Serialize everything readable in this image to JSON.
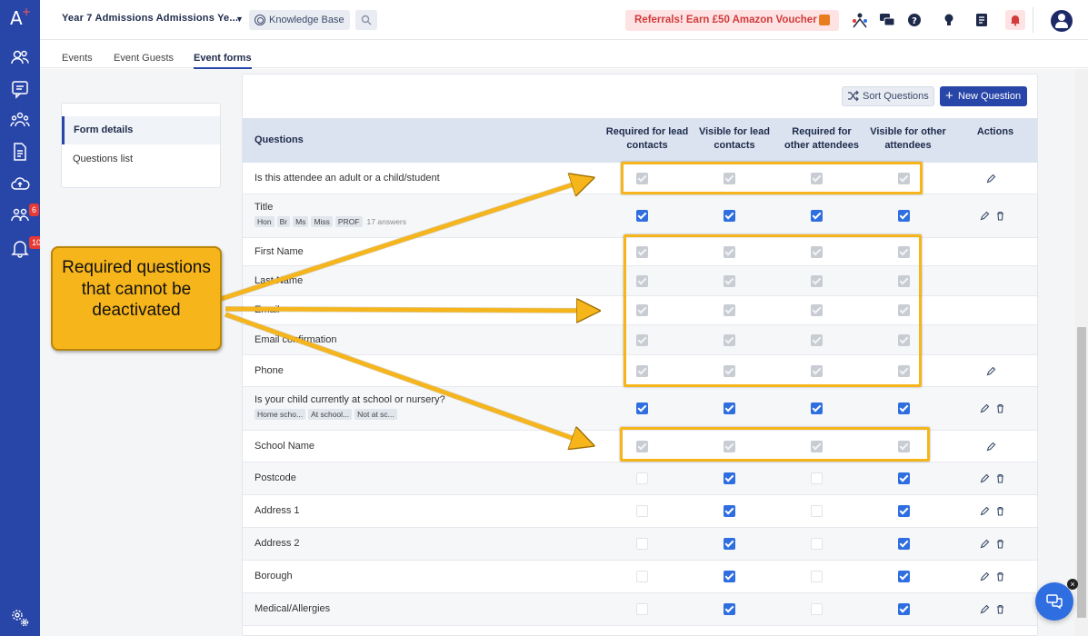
{
  "app": {
    "logo": "A",
    "logo_plus": "+"
  },
  "leftnav": {
    "items": [
      {
        "icon": "people-icon"
      },
      {
        "icon": "chat-icon"
      },
      {
        "icon": "group-icon"
      },
      {
        "icon": "document-icon"
      },
      {
        "icon": "upload-cloud-icon"
      },
      {
        "icon": "team-icon",
        "badge": "6"
      },
      {
        "icon": "bell-icon",
        "badge": "10"
      },
      {
        "icon": "settings-icon"
      }
    ]
  },
  "topbar": {
    "project_title": "Year 7 Admissions Admissions Ye...",
    "knowledge_base": "Knowledge Base",
    "referral": "Referrals! Earn £50 Amazon Voucher"
  },
  "subnav": {
    "tabs": [
      "Events",
      "Event Guests",
      "Event forms"
    ],
    "active": "Event forms"
  },
  "sidepanel": {
    "items": [
      "Form details",
      "Questions list"
    ]
  },
  "toolbar": {
    "sort_label": "Sort Questions",
    "new_label": "New Question"
  },
  "table": {
    "headers": {
      "questions": "Questions",
      "req_lead": [
        "Required for lead",
        "contacts"
      ],
      "vis_lead": [
        "Visible for lead",
        "contacts"
      ],
      "req_other": [
        "Required for",
        "other attendees"
      ],
      "vis_other": [
        "Visible for other",
        "attendees"
      ],
      "actions": "Actions"
    },
    "rows": [
      {
        "label": "Is this attendee an adult or a child/student",
        "state": [
          "locked",
          "locked",
          "locked",
          "locked"
        ],
        "actions": [
          "edit"
        ]
      },
      {
        "label": "Title",
        "chips": [
          "Hon",
          "Br",
          "Ms",
          "Miss",
          "PROF"
        ],
        "chip_meta": "17 answers",
        "state": [
          "checked",
          "checked",
          "checked",
          "checked"
        ],
        "actions": [
          "edit",
          "delete"
        ]
      },
      {
        "label": "First Name",
        "state": [
          "locked",
          "locked",
          "locked",
          "locked"
        ],
        "actions": []
      },
      {
        "label": "Last Name",
        "state": [
          "locked",
          "locked",
          "locked",
          "locked"
        ],
        "actions": []
      },
      {
        "label": "Email",
        "state": [
          "locked",
          "locked",
          "locked",
          "locked"
        ],
        "actions": []
      },
      {
        "label": "Email confirmation",
        "state": [
          "locked",
          "locked",
          "locked",
          "locked"
        ],
        "actions": []
      },
      {
        "label": "Phone",
        "state": [
          "locked",
          "locked",
          "locked",
          "locked"
        ],
        "actions": [
          "edit"
        ]
      },
      {
        "label": "Is your child currently at school or nursery?",
        "chips": [
          "Home scho...",
          "At school...",
          "Not at sc..."
        ],
        "state": [
          "checked",
          "checked",
          "checked",
          "checked"
        ],
        "actions": [
          "edit",
          "delete"
        ]
      },
      {
        "label": "School Name",
        "state": [
          "locked",
          "locked",
          "locked",
          "locked"
        ],
        "actions": [
          "edit"
        ]
      },
      {
        "label": "Postcode",
        "state": [
          "empty",
          "checked",
          "empty",
          "checked"
        ],
        "actions": [
          "edit",
          "delete"
        ]
      },
      {
        "label": "Address 1",
        "state": [
          "empty",
          "checked",
          "empty",
          "checked"
        ],
        "actions": [
          "edit",
          "delete"
        ]
      },
      {
        "label": "Address 2",
        "state": [
          "empty",
          "checked",
          "empty",
          "checked"
        ],
        "actions": [
          "edit",
          "delete"
        ]
      },
      {
        "label": "Borough",
        "state": [
          "empty",
          "checked",
          "empty",
          "checked"
        ],
        "actions": [
          "edit",
          "delete"
        ]
      },
      {
        "label": "Medical/Allergies",
        "state": [
          "empty",
          "checked",
          "empty",
          "checked"
        ],
        "actions": [
          "edit",
          "delete"
        ]
      }
    ]
  },
  "annotation": {
    "text": "Required questions that cannot be deactivated"
  },
  "colors": {
    "nav": "#2845a8",
    "accent": "#2f6ee0",
    "annotation": "#f6b51a",
    "referral_text": "#d23b3b"
  }
}
